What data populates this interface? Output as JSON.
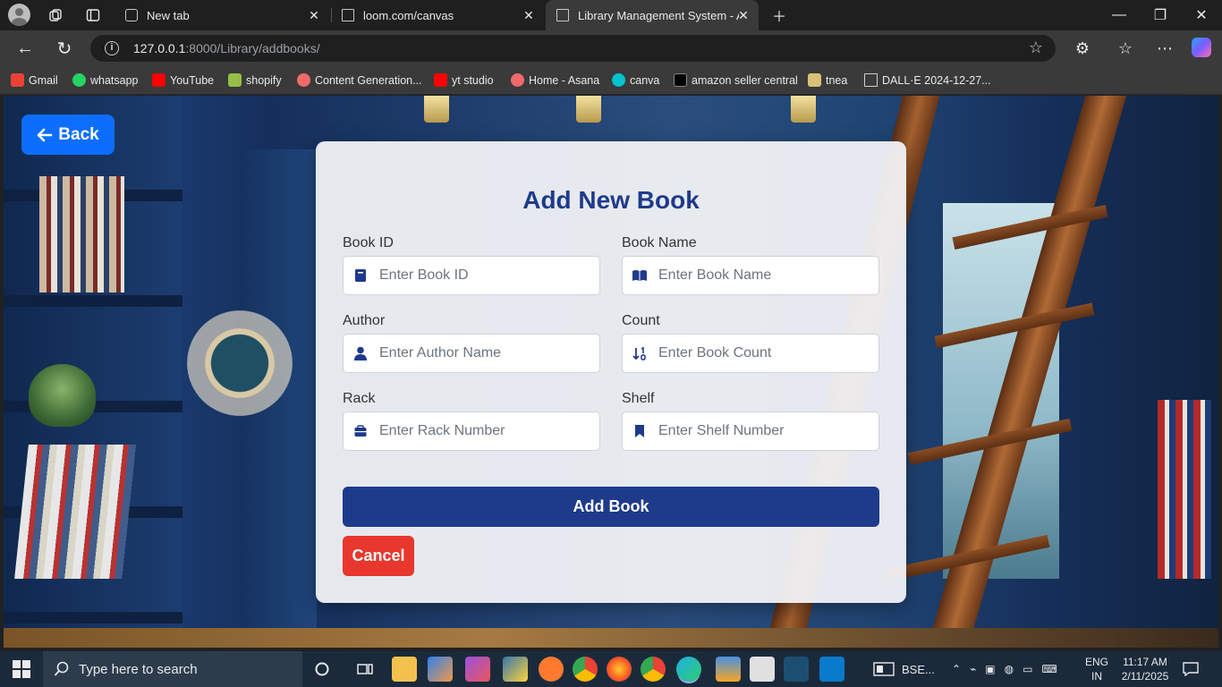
{
  "browser": {
    "tabs": [
      {
        "title": "New tab",
        "active": false
      },
      {
        "title": "loom.com/canvas",
        "active": false
      },
      {
        "title": "Library Management System - Ad",
        "active": true
      }
    ],
    "url": {
      "host": "127.0.0.1",
      "rest": ":8000/Library/addbooks/"
    },
    "bookmarks": [
      {
        "label": "Gmail",
        "icon": "gmail-icon",
        "color": "#ea4335"
      },
      {
        "label": "whatsapp",
        "icon": "whatsapp-icon",
        "color": "#25d366"
      },
      {
        "label": "YouTube",
        "icon": "youtube-icon",
        "color": "#ff0000"
      },
      {
        "label": "shopify",
        "icon": "shopify-icon",
        "color": "#95bf47"
      },
      {
        "label": "Content Generation...",
        "icon": "asana-icon",
        "color": "#f06a6a"
      },
      {
        "label": "yt studio",
        "icon": "youtube-icon",
        "color": "#ff0000"
      },
      {
        "label": "Home - Asana",
        "icon": "asana-icon",
        "color": "#f06a6a"
      },
      {
        "label": "canva",
        "icon": "canva-icon",
        "color": "#00c4cc"
      },
      {
        "label": "amazon seller central",
        "icon": "amazon-icon",
        "color": "#000000"
      },
      {
        "label": "tnea",
        "icon": "tnea-icon",
        "color": "#d8c27a"
      },
      {
        "label": "DALL·E 2024-12-27...",
        "icon": "file-icon",
        "color": "#cfcfcf"
      }
    ]
  },
  "page": {
    "back_label": "Back",
    "title": "Add New Book",
    "fields": {
      "book_id": {
        "label": "Book ID",
        "placeholder": "Enter Book ID"
      },
      "book_name": {
        "label": "Book Name",
        "placeholder": "Enter Book Name"
      },
      "author": {
        "label": "Author",
        "placeholder": "Enter Author Name"
      },
      "count": {
        "label": "Count",
        "placeholder": "Enter Book Count"
      },
      "rack": {
        "label": "Rack",
        "placeholder": "Enter Rack Number"
      },
      "shelf": {
        "label": "Shelf",
        "placeholder": "Enter Shelf Number"
      }
    },
    "add_label": "Add Book",
    "cancel_label": "Cancel",
    "colors": {
      "accent": "#1e3a8a",
      "back": "#0d6efd",
      "cancel": "#e8372c"
    }
  },
  "taskbar": {
    "search_placeholder": "Type here to search",
    "app_label": "BSE...",
    "lang": "ENG",
    "region": "IN",
    "time": "11:17 AM",
    "date": "2/11/2025"
  }
}
